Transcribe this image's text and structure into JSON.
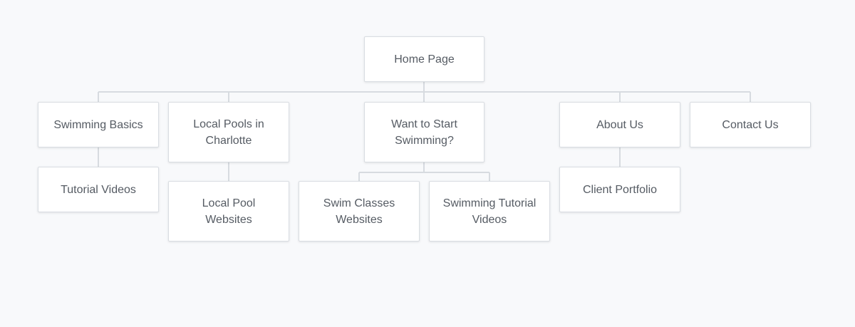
{
  "sitemap": {
    "root": "Home Page",
    "swimming_basics": {
      "label": "Swimming Basics",
      "children": [
        "Tutorial Videos"
      ]
    },
    "local_pools": {
      "label": "Local Pools in\nCharlotte",
      "children": [
        "Local Pool\nWebsites"
      ]
    },
    "want_to_start": {
      "label": "Want to Start\nSwimming?",
      "children": [
        "Swim Classes\nWebsites",
        "Swimming Tutorial\nVideos"
      ]
    },
    "about_us": {
      "label": "About Us",
      "children": [
        "Client Portfolio"
      ]
    },
    "contact_us": {
      "label": "Contact Us"
    }
  },
  "colors": {
    "background": "#f8f9fb",
    "node_fill": "#ffffff",
    "node_border": "#d9dde2",
    "connector": "#d7dbe0",
    "text": "#555b63"
  }
}
